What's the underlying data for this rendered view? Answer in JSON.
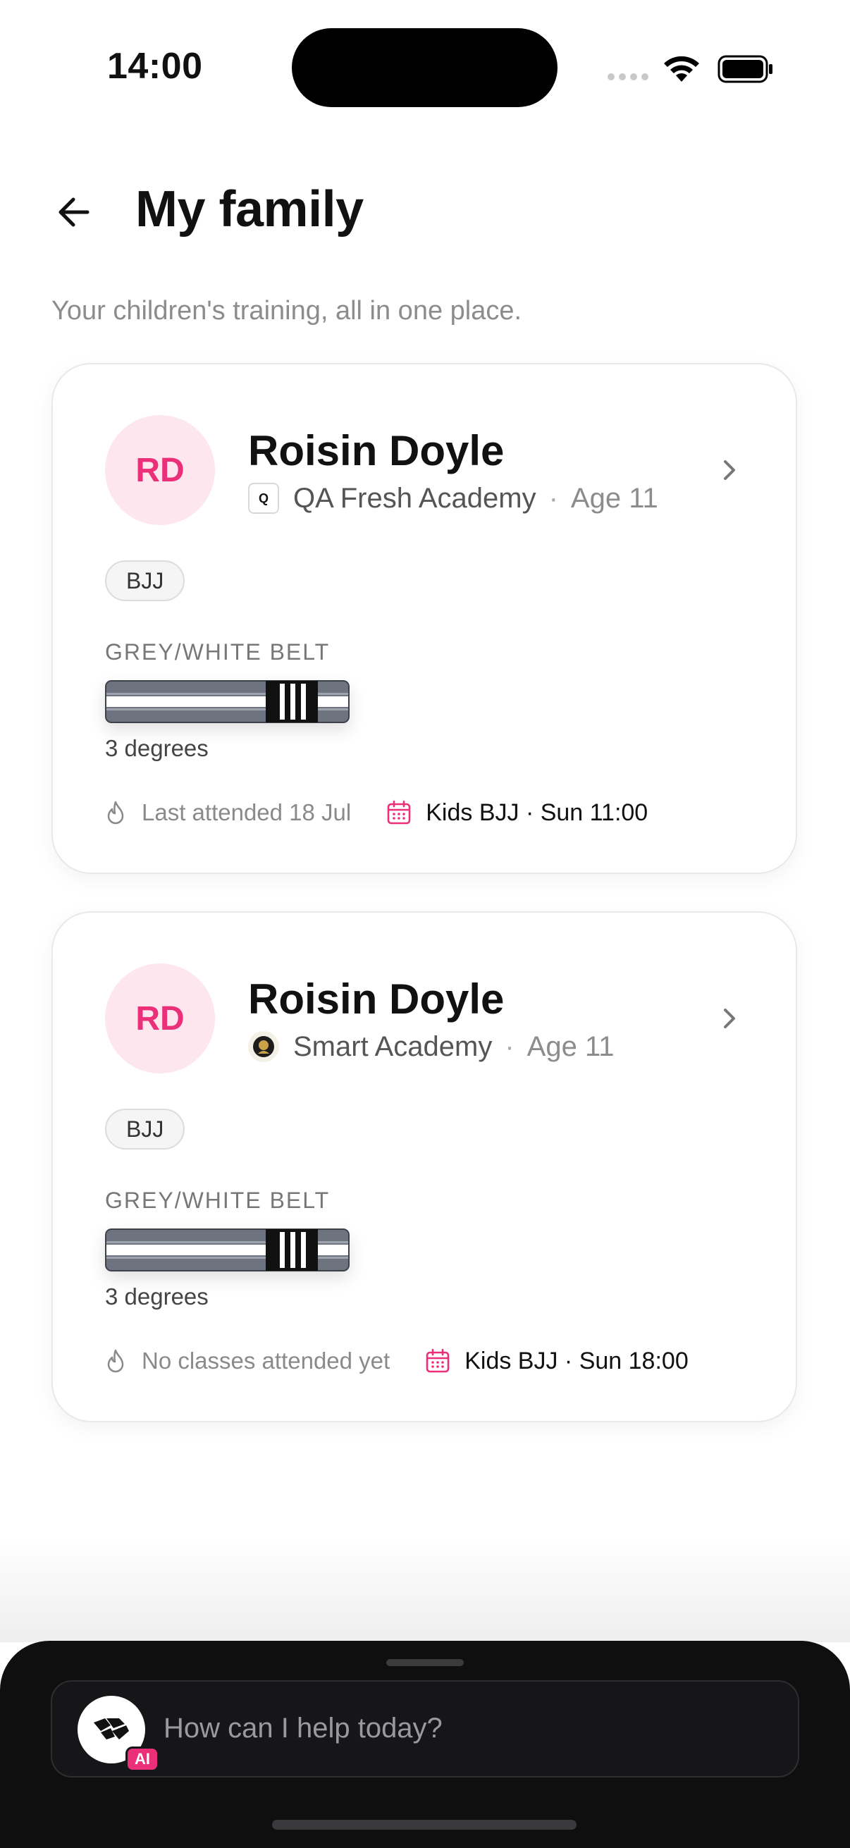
{
  "status_bar": {
    "time": "14:00"
  },
  "header": {
    "title": "My family",
    "subtitle": "Your children's training, all in one place."
  },
  "children": [
    {
      "initials": "RD",
      "name": "Roisin Doyle",
      "academy_logo_text": "Q",
      "academy": "QA Fresh Academy",
      "separator": "·",
      "age": "Age 11",
      "discipline": "BJJ",
      "belt_label": "GREY/WHITE BELT",
      "degrees_text": "3 degrees",
      "degrees": 3,
      "last_attended": "Last attended 18 Jul",
      "next_class": "Kids BJJ · Sun 11:00"
    },
    {
      "initials": "RD",
      "name": "Roisin Doyle",
      "academy": "Smart Academy",
      "separator": "·",
      "age": "Age 11",
      "discipline": "BJJ",
      "belt_label": "GREY/WHITE BELT",
      "degrees_text": "3 degrees",
      "degrees": 3,
      "last_attended": "No classes attended yet",
      "next_class": "Kids BJJ · Sun 18:00"
    }
  ],
  "assistant": {
    "placeholder": "How can I help today?",
    "badge": "AI"
  },
  "colors": {
    "accent": "#ec2f79",
    "avatar_bg": "#fde6ee",
    "sheet_bg": "#0f0f10"
  }
}
